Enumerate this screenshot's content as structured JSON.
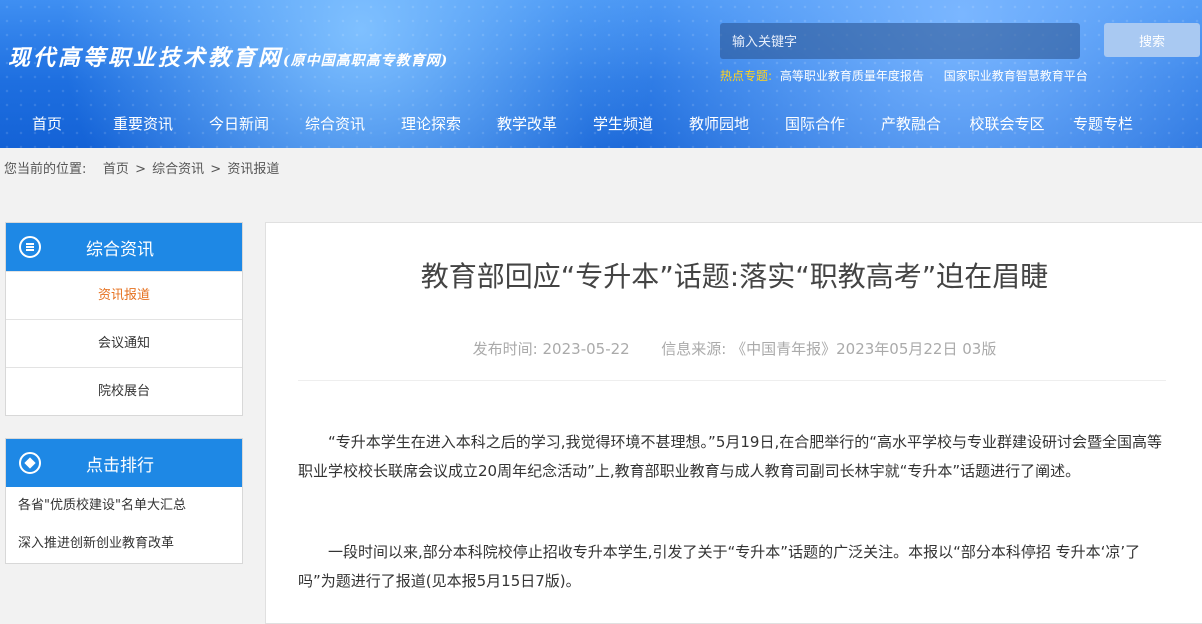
{
  "header": {
    "logo_main": "现代高等职业技术教育网",
    "logo_sub": "(原中国高职高专教育网)",
    "search_placeholder": "输入关键字",
    "search_button": "搜索",
    "hot_label": "热点专题:",
    "hot_links": [
      "高等职业教育质量年度报告",
      "国家职业教育智慧教育平台"
    ],
    "nav": [
      "首页",
      "重要资讯",
      "今日新闻",
      "综合资讯",
      "理论探索",
      "教学改革",
      "学生频道",
      "教师园地",
      "国际合作",
      "产教融合",
      "校联会专区",
      "专题专栏"
    ]
  },
  "breadcrumb": {
    "prefix": "您当前的位置:",
    "items": [
      "首页",
      "综合资讯",
      "资讯报道"
    ],
    "separator": ">"
  },
  "sidebar": {
    "category": {
      "title": "综合资讯",
      "icon": "list-icon",
      "items": [
        "资讯报道",
        "会议通知",
        "院校展台"
      ],
      "active_index": 0
    },
    "ranking": {
      "title": "点击排行",
      "icon": "ranking-icon",
      "items": [
        "各省\"优质校建设\"名单大汇总",
        "深入推进创新创业教育改革"
      ]
    }
  },
  "article": {
    "title": "教育部回应“专升本”话题:落实“职教高考”迫在眉睫",
    "publish_label": "发布时间:",
    "publish_date": "2023-05-22",
    "source_label": "信息来源:",
    "source_value": "《中国青年报》2023年05月22日 03版",
    "paragraphs": [
      "“专升本学生在进入本科之后的学习,我觉得环境不甚理想。”5月19日,在合肥举行的“高水平学校与专业群建设研讨会暨全国高等职业学校校长联席会议成立20周年纪念活动”上,教育部职业教育与成人教育司副司长林宇就“专升本”话题进行了阐述。",
      "一段时间以来,部分本科院校停止招收专升本学生,引发了关于“专升本”话题的广泛关注。本报以“部分本科停招 专升本‘凉’了吗”为题进行了报道(见本报5月15日7版)。"
    ]
  },
  "colors": {
    "primary_blue": "#1e88e5",
    "active_orange": "#e6711f",
    "hot_label_yellow": "#ffd21e"
  }
}
